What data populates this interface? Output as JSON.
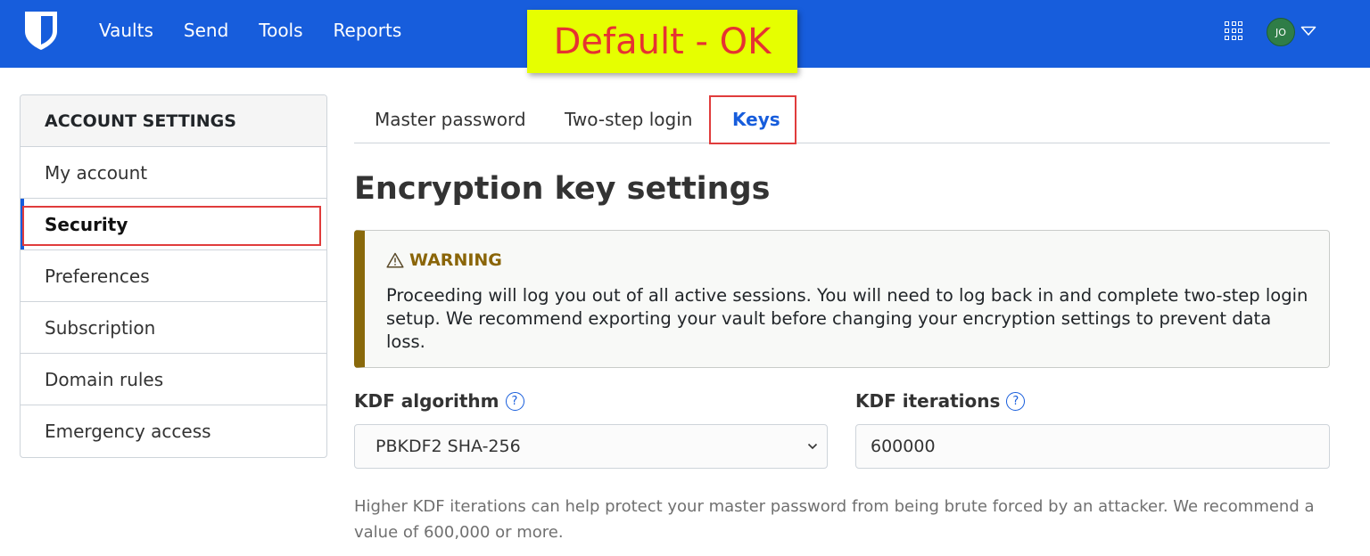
{
  "nav": {
    "items": [
      "Vaults",
      "Send",
      "Tools",
      "Reports"
    ],
    "avatar_initials": "JO",
    "brand_color": "#175ddc"
  },
  "annotation": {
    "label": "Default - OK",
    "label_bg": "#e6ff00",
    "label_color": "#e63232",
    "box_color": "#e03c3c"
  },
  "sidebar": {
    "heading": "ACCOUNT SETTINGS",
    "items": [
      {
        "label": "My account"
      },
      {
        "label": "Security",
        "active": true
      },
      {
        "label": "Preferences"
      },
      {
        "label": "Subscription"
      },
      {
        "label": "Domain rules"
      },
      {
        "label": "Emergency access"
      }
    ]
  },
  "tabs": [
    {
      "label": "Master password"
    },
    {
      "label": "Two-step login"
    },
    {
      "label": "Keys",
      "active": true
    }
  ],
  "main": {
    "title": "Encryption key settings",
    "warning": {
      "title": "WARNING",
      "body": "Proceeding will log you out of all active sessions. You will need to log back in and complete two-step login setup. We recommend exporting your vault before changing your encryption settings to prevent data loss."
    },
    "kdf_algorithm": {
      "label": "KDF algorithm",
      "value": "PBKDF2 SHA-256"
    },
    "kdf_iterations": {
      "label": "KDF iterations",
      "value": "600000"
    },
    "hint": "Higher KDF iterations can help protect your master password from being brute forced by an attacker. We recommend a value of 600,000 or more."
  }
}
